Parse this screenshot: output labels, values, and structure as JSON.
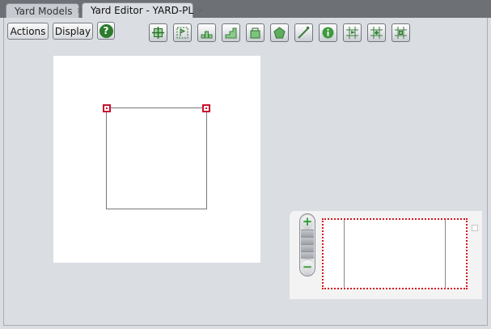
{
  "tabs": [
    {
      "label": "Yard Models",
      "close": "×"
    },
    {
      "label": "Yard Editor - YARD-PL",
      "close": "×"
    }
  ],
  "toolbar": {
    "actions_label": "Actions",
    "display_label": "Display",
    "help_label": "?"
  },
  "tools": [
    {
      "icon": "move-crosshair-icon"
    },
    {
      "icon": "select-flag-icon"
    },
    {
      "icon": "stack-blocks-icon"
    },
    {
      "icon": "stairs-icon"
    },
    {
      "icon": "container-icon"
    },
    {
      "icon": "pentagon-shape-icon"
    },
    {
      "icon": "line-tool-icon"
    },
    {
      "icon": "info-icon"
    },
    {
      "icon": "flag-grid-icon"
    },
    {
      "icon": "add-grid-icon"
    },
    {
      "icon": "grid-move-icon"
    }
  ],
  "zoom": {
    "plus_label": "+",
    "minus_label": "−"
  },
  "colors": {
    "handle": "#c8102e",
    "viewport_border": "#d2141c",
    "help_green": "#2c7b2c"
  }
}
